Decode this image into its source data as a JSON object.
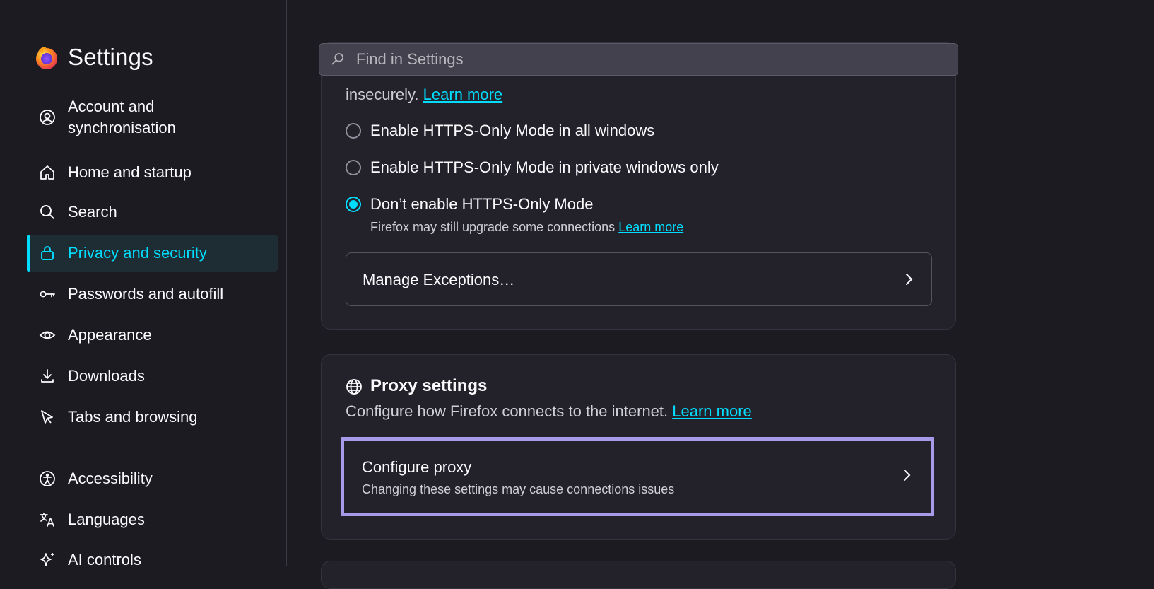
{
  "app": {
    "title": "Settings"
  },
  "sidebar": {
    "items": [
      {
        "label": "Account and synchronisation",
        "icon": "account-circle-icon"
      },
      {
        "label": "Home and startup",
        "icon": "home-icon"
      },
      {
        "label": "Search",
        "icon": "search-icon"
      },
      {
        "label": "Privacy and security",
        "icon": "lock-icon",
        "selected": true
      },
      {
        "label": "Passwords and autofill",
        "icon": "key-icon"
      },
      {
        "label": "Appearance",
        "icon": "eye-icon"
      },
      {
        "label": "Downloads",
        "icon": "download-icon"
      },
      {
        "label": "Tabs and browsing",
        "icon": "cursor-icon"
      },
      {
        "label": "Accessibility",
        "icon": "accessibility-icon"
      },
      {
        "label": "Languages",
        "icon": "translate-icon"
      },
      {
        "label": "AI controls",
        "icon": "sparkle-icon"
      }
    ]
  },
  "search": {
    "placeholder": "Find in Settings"
  },
  "https_section": {
    "intro_tail": "insecurely.",
    "intro_link": "Learn more",
    "options": [
      {
        "label": "Enable HTTPS-Only Mode in all windows",
        "checked": false
      },
      {
        "label": "Enable HTTPS-Only Mode in private windows only",
        "checked": false
      },
      {
        "label": "Don’t enable HTTPS-Only Mode",
        "checked": true
      }
    ],
    "note": "Firefox may still upgrade some connections",
    "note_link": "Learn more",
    "manage_exceptions": "Manage Exceptions…"
  },
  "proxy_section": {
    "title": "Proxy settings",
    "description": "Configure how Firefox connects to the internet.",
    "description_link": "Learn more",
    "configure_title": "Configure proxy",
    "configure_subtitle": "Changing these settings may cause connections issues"
  },
  "colors": {
    "background": "#1c1b22",
    "card": "#23222b",
    "accent": "#00ddff",
    "highlight": "#a79be9"
  }
}
